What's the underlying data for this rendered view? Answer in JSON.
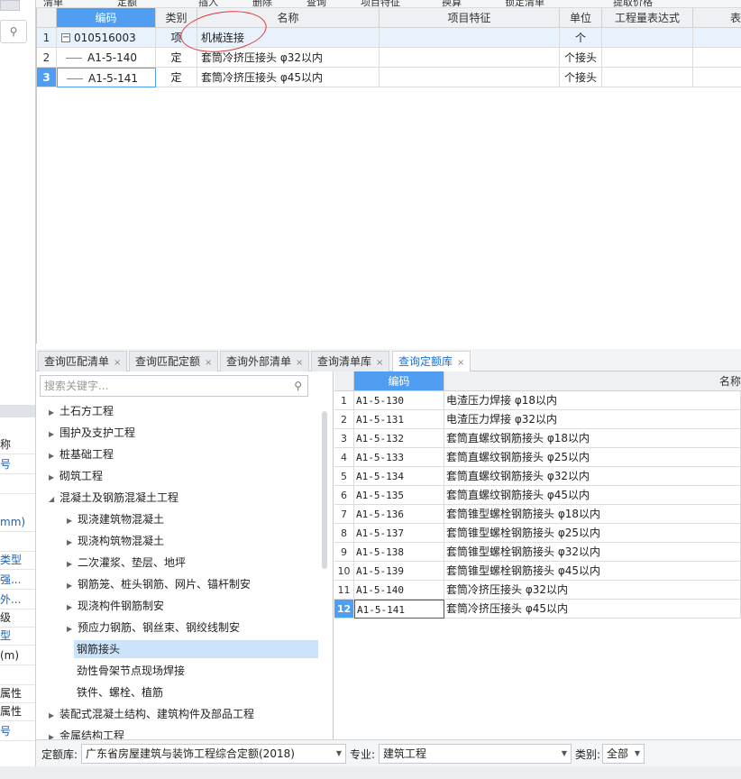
{
  "toolbar": {
    "items": [
      "清单",
      "定额",
      "插入",
      "删除",
      "查询",
      "项目特征",
      "换算",
      "锁定清单",
      "提取价格"
    ]
  },
  "left_strip": {
    "search_icon": "search-icon",
    "rows": [
      "称",
      "号",
      "",
      "mm)",
      "",
      "类型",
      "强...",
      "外...",
      "级",
      "(m)",
      "型",
      "",
      "属性",
      "属性",
      "号"
    ]
  },
  "top_grid": {
    "headers": [
      "编码",
      "类别",
      "名称",
      "项目特征",
      "单位",
      "工程量表达式",
      "表"
    ],
    "rows": [
      {
        "num": "1",
        "code": "010516003",
        "type": "项",
        "name": "机械连接",
        "feature": "",
        "unit": "个",
        "expr": ""
      },
      {
        "num": "2",
        "code": "A1-5-140",
        "type": "定",
        "name": "套筒冷挤压接头 φ32以内",
        "feature": "",
        "unit": "个接头",
        "expr": ""
      },
      {
        "num": "3",
        "code": "A1-5-141",
        "type": "定",
        "name": "套筒冷挤压接头 φ45以内",
        "feature": "",
        "unit": "个接头",
        "expr": ""
      }
    ]
  },
  "tabs": [
    {
      "label": "查询匹配清单",
      "close": "×"
    },
    {
      "label": "查询匹配定额",
      "close": "×"
    },
    {
      "label": "查询外部清单",
      "close": "×"
    },
    {
      "label": "查询清单库",
      "close": "×"
    },
    {
      "label": "查询定额库",
      "close": "×"
    }
  ],
  "search": {
    "placeholder": "搜索关键字..."
  },
  "tree": [
    {
      "label": "土石方工程",
      "arrow": "▶",
      "level": 0
    },
    {
      "label": "围护及支护工程",
      "arrow": "▶",
      "level": 0
    },
    {
      "label": "桩基础工程",
      "arrow": "▶",
      "level": 0
    },
    {
      "label": "砌筑工程",
      "arrow": "▶",
      "level": 0
    },
    {
      "label": "混凝土及钢筋混凝土工程",
      "arrow": "◢",
      "level": 0
    },
    {
      "label": "现浇建筑物混凝土",
      "arrow": "▶",
      "level": 1
    },
    {
      "label": "现浇构筑物混凝土",
      "arrow": "▶",
      "level": 1
    },
    {
      "label": "二次灌浆、垫层、地坪",
      "arrow": "▶",
      "level": 1
    },
    {
      "label": "钢筋笼、桩头钢筋、网片、锚杆制安",
      "arrow": "▶",
      "level": 1
    },
    {
      "label": "现浇构件钢筋制安",
      "arrow": "▶",
      "level": 1
    },
    {
      "label": "预应力钢筋、钢丝束、钢绞线制安",
      "arrow": "▶",
      "level": 1
    },
    {
      "label": "钢筋接头",
      "arrow": "",
      "level": 1
    },
    {
      "label": "劲性骨架节点现场焊接",
      "arrow": "",
      "level": 1
    },
    {
      "label": "铁件、螺栓、植筋",
      "arrow": "",
      "level": 1
    },
    {
      "label": "装配式混凝土结构、建筑构件及部品工程",
      "arrow": "▶",
      "level": 0
    },
    {
      "label": "金属结构工程",
      "arrow": "▶",
      "level": 0
    }
  ],
  "right_grid": {
    "headers": [
      "编码",
      "名称"
    ],
    "rows": [
      {
        "num": "1",
        "code": "A1-5-130",
        "name": "电渣压力焊接 φ18以内"
      },
      {
        "num": "2",
        "code": "A1-5-131",
        "name": "电渣压力焊接 φ32以内"
      },
      {
        "num": "3",
        "code": "A1-5-132",
        "name": "套筒直螺纹钢筋接头 φ18以内"
      },
      {
        "num": "4",
        "code": "A1-5-133",
        "name": "套筒直螺纹钢筋接头 φ25以内"
      },
      {
        "num": "5",
        "code": "A1-5-134",
        "name": "套筒直螺纹钢筋接头 φ32以内"
      },
      {
        "num": "6",
        "code": "A1-5-135",
        "name": "套筒直螺纹钢筋接头 φ45以内"
      },
      {
        "num": "7",
        "code": "A1-5-136",
        "name": "套筒锥型螺栓钢筋接头 φ18以内"
      },
      {
        "num": "8",
        "code": "A1-5-137",
        "name": "套筒锥型螺栓钢筋接头 φ25以内"
      },
      {
        "num": "9",
        "code": "A1-5-138",
        "name": "套筒锥型螺栓钢筋接头 φ32以内"
      },
      {
        "num": "10",
        "code": "A1-5-139",
        "name": "套筒锥型螺栓钢筋接头 φ45以内"
      },
      {
        "num": "11",
        "code": "A1-5-140",
        "name": "套筒冷挤压接头 φ32以内"
      },
      {
        "num": "12",
        "code": "A1-5-141",
        "name": "套筒冷挤压接头 φ45以内"
      }
    ]
  },
  "bottom": {
    "library_label": "定额库:",
    "library_value": "广东省房屋建筑与装饰工程综合定额(2018)",
    "major_label": "专业:",
    "major_value": "建筑工程",
    "category_label": "类别:",
    "category_value": "全部"
  },
  "colors": {
    "accent": "#4f9ef2",
    "highlight": "#e8f2fd",
    "annotation": "#e0353a"
  }
}
